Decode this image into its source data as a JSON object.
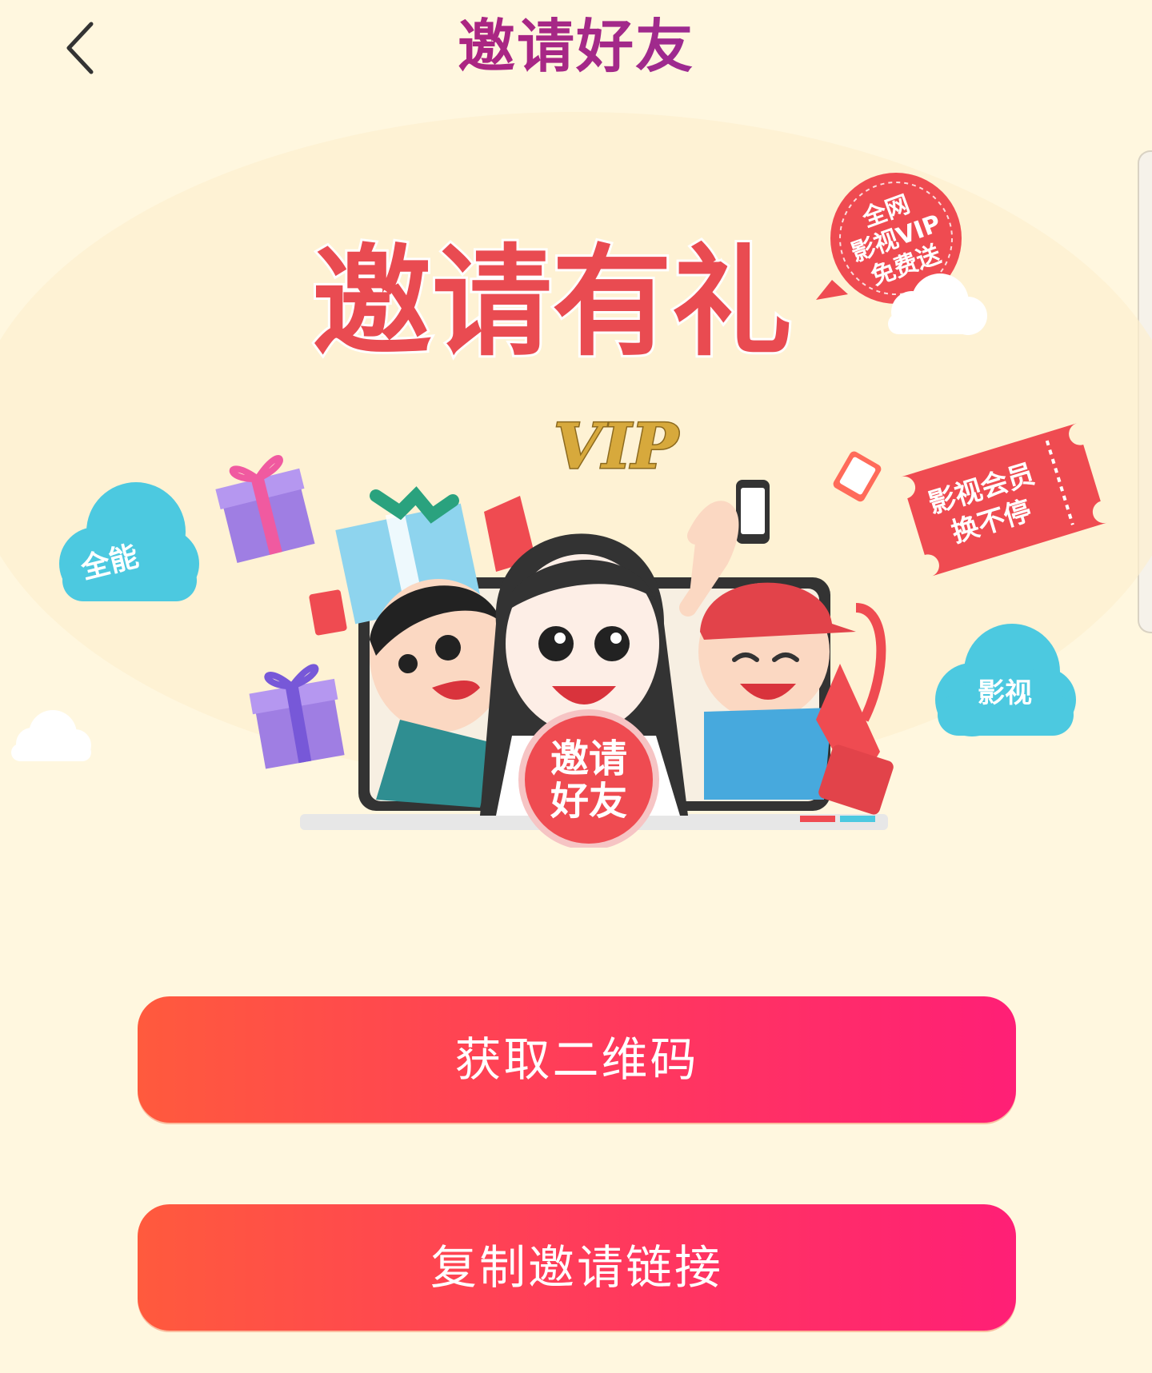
{
  "header": {
    "title": "邀请好友",
    "back_icon": "chevron-left-icon"
  },
  "banner": {
    "headline": "邀请有礼",
    "badge_lines": [
      "全网",
      "影视VIP",
      "免费送"
    ],
    "ticket_lines": [
      "影视会员",
      "换不停"
    ],
    "cloud_left": "全能",
    "cloud_right": "影视",
    "vip_logo": "VIP",
    "medal_lines": [
      "邀请",
      "好友"
    ]
  },
  "actions": {
    "qr_label": "获取二维码",
    "copy_label": "复制邀请链接"
  },
  "colors": {
    "background": "#fff7df",
    "accent_start": "#ff5a3d",
    "accent_end": "#ff1f76",
    "headline_red": "#e94b51"
  }
}
